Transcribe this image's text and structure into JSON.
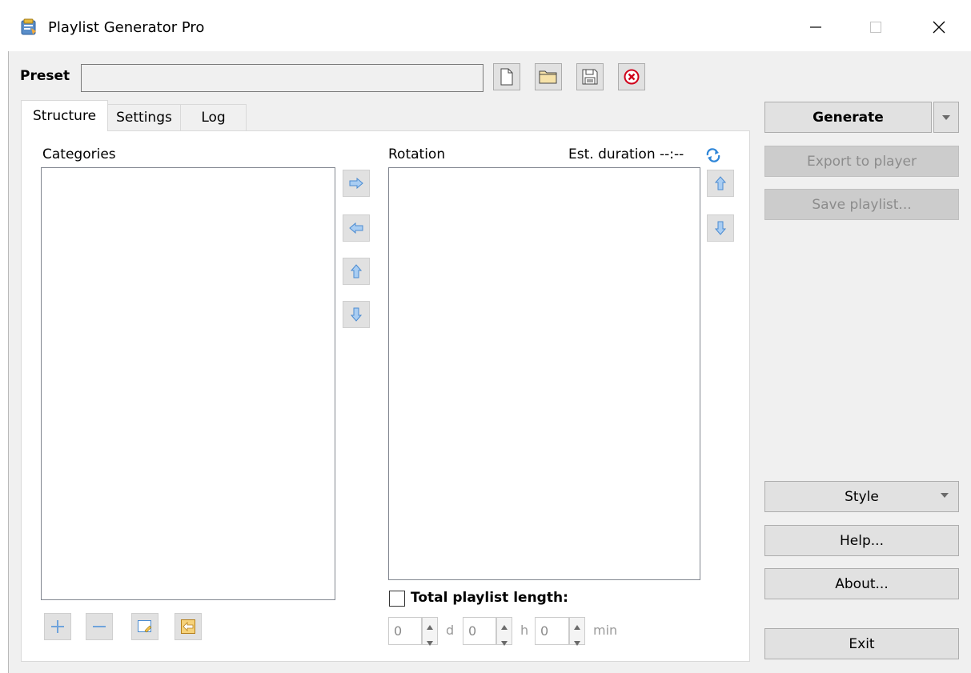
{
  "window": {
    "title": "Playlist Generator Pro",
    "minimize_glyph": "—",
    "close_glyph": "✕"
  },
  "preset": {
    "label": "Preset",
    "value": ""
  },
  "tabs": [
    {
      "label": "Structure",
      "active": true
    },
    {
      "label": "Settings",
      "active": false
    },
    {
      "label": "Log",
      "active": false
    }
  ],
  "structure": {
    "categories_label": "Categories",
    "rotation_label": "Rotation",
    "duration_label": "Est. duration --:--",
    "categories_items": [],
    "rotation_items": [],
    "total_length": {
      "label": "Total playlist length:",
      "checked": false,
      "days": "0",
      "days_unit": "d",
      "hours": "0",
      "hours_unit": "h",
      "minutes": "0",
      "minutes_unit": "min"
    }
  },
  "sidebar": {
    "generate": "Generate",
    "export": "Export to player",
    "save_playlist": "Save playlist...",
    "style": "Style",
    "help": "Help...",
    "about": "About...",
    "exit": "Exit"
  },
  "colors": {
    "accent_arrow": "#5b9bd5",
    "delete_red": "#d0021b",
    "disabled_text": "#8c8c8c"
  },
  "icons": {
    "app": "playlist-app-icon",
    "new": "new-file-icon",
    "open": "open-folder-icon",
    "save": "floppy-disk-icon",
    "delete": "delete-circle-icon",
    "refresh": "refresh-icon"
  }
}
